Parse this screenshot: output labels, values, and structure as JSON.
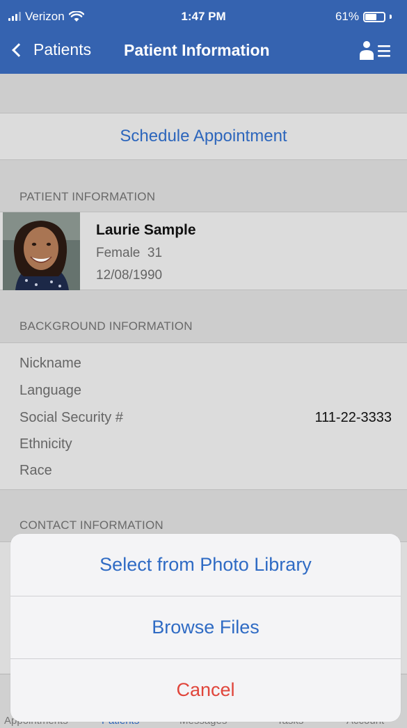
{
  "status": {
    "carrier": "Verizon",
    "time": "1:47 PM",
    "battery": "61%",
    "battery_level": 0.61
  },
  "nav": {
    "back_label": "Patients",
    "title": "Patient Information"
  },
  "schedule_button": "Schedule Appointment",
  "patient_section": {
    "header": "PATIENT INFORMATION",
    "name": "Laurie Sample",
    "sex_age": "Female  31",
    "dob": "12/08/1990"
  },
  "background_section": {
    "header": "BACKGROUND INFORMATION",
    "rows": [
      {
        "label": "Nickname",
        "value": ""
      },
      {
        "label": "Language",
        "value": ""
      },
      {
        "label": "Social Security #",
        "value": "111-22-3333"
      },
      {
        "label": "Ethnicity",
        "value": ""
      },
      {
        "label": "Race",
        "value": ""
      }
    ]
  },
  "contact_section": {
    "header": "CONTACT INFORMATION"
  },
  "action_sheet": {
    "photo_library": "Select from Photo Library",
    "browse_files": "Browse Files",
    "cancel": "Cancel"
  },
  "tabs": [
    "Appointments",
    "Patients",
    "Messages",
    "Tasks",
    "Account"
  ],
  "colors": {
    "nav_bg": "#3563b0",
    "link": "#2f6bc4",
    "destructive": "#e0453b"
  }
}
